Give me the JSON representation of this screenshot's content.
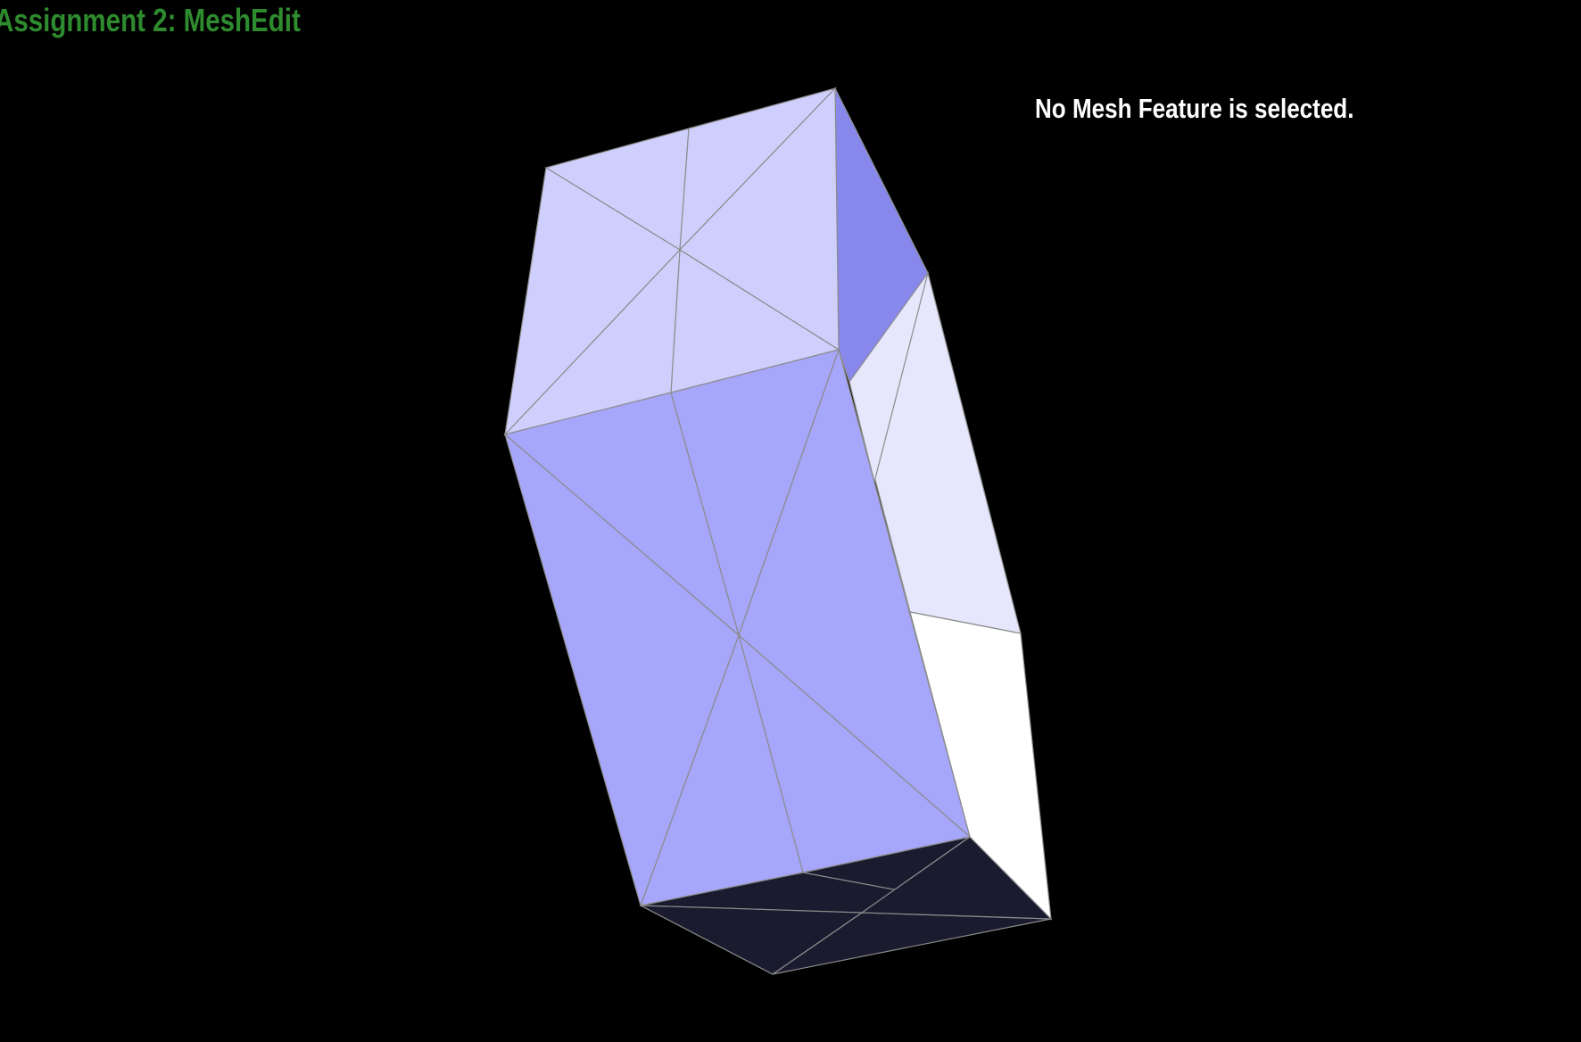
{
  "app": {
    "title": "Assignment 2: MeshEdit",
    "title_color": "#2e8b2e"
  },
  "status": {
    "selection_text": "No Mesh Feature is selected."
  },
  "viewer": {
    "background": "#000000",
    "edge_color": "#8c8c8c",
    "face_colors": {
      "top": "#cfcffe",
      "front": "#a6a6fb",
      "right_upper": "#8787ec",
      "right": "#e6e6fd",
      "right_lower": "#ffffff",
      "bottom": "#1b1b30"
    }
  }
}
